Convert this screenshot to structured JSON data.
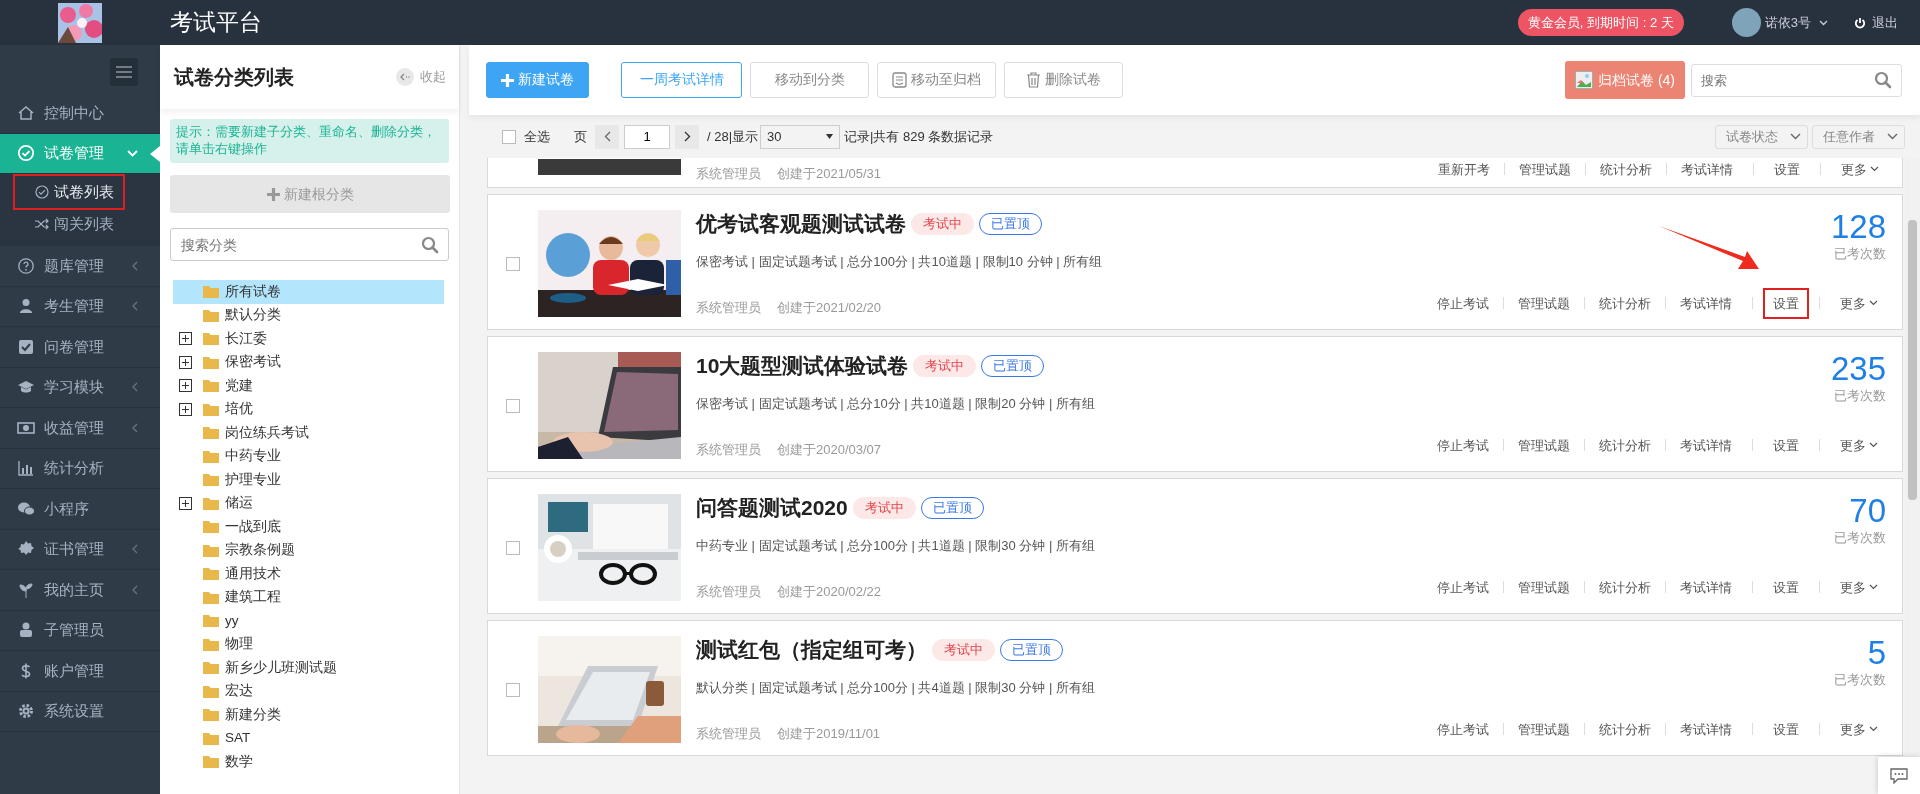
{
  "header": {
    "title": "考试平台",
    "membership": "黄金会员, 到期时间 : 2 天",
    "user": "诺依3号",
    "logout": "退出"
  },
  "sidebar": {
    "items": [
      {
        "label": "控制中心",
        "selected": false
      },
      {
        "label": "试卷管理",
        "selected": true,
        "expanded": true,
        "children": [
          {
            "label": "试卷列表",
            "selected": true,
            "highlighted": true
          },
          {
            "label": "闯关列表",
            "selected": false,
            "highlighted": false
          }
        ]
      },
      {
        "label": "题库管理",
        "selected": false,
        "expanded": false
      },
      {
        "label": "考生管理",
        "selected": false,
        "expanded": false
      },
      {
        "label": "问卷管理",
        "selected": false
      },
      {
        "label": "学习模块",
        "selected": false,
        "expanded": false
      },
      {
        "label": "收益管理",
        "selected": false,
        "expanded": false
      },
      {
        "label": "统计分析",
        "selected": false
      },
      {
        "label": "小程序",
        "selected": false
      },
      {
        "label": "证书管理",
        "selected": false,
        "expanded": false
      },
      {
        "label": "我的主页",
        "selected": false,
        "expanded": false
      },
      {
        "label": "子管理员",
        "selected": false
      },
      {
        "label": "账户管理",
        "selected": false
      },
      {
        "label": "系统设置",
        "selected": false
      }
    ]
  },
  "category_panel": {
    "title": "试卷分类列表",
    "collapse": "收起",
    "hint": "提示：需要新建子分类、重命名、删除分类，请单击右键操作",
    "new_root": "新建根分类",
    "search": {
      "placeholder": "搜索分类"
    },
    "tree": [
      {
        "label": "所有试卷",
        "has_children": false,
        "selected": true
      },
      {
        "label": "默认分类",
        "has_children": false,
        "selected": false
      },
      {
        "label": "长江委",
        "has_children": true,
        "selected": false
      },
      {
        "label": "保密考试",
        "has_children": true,
        "selected": false
      },
      {
        "label": "党建",
        "has_children": true,
        "selected": false
      },
      {
        "label": "培优",
        "has_children": true,
        "selected": false
      },
      {
        "label": "岗位练兵考试",
        "has_children": false,
        "selected": false
      },
      {
        "label": "中药专业",
        "has_children": false,
        "selected": false
      },
      {
        "label": "护理专业",
        "has_children": false,
        "selected": false
      },
      {
        "label": "储运",
        "has_children": true,
        "selected": false
      },
      {
        "label": "一战到底",
        "has_children": false,
        "selected": false
      },
      {
        "label": "宗教条例题",
        "has_children": false,
        "selected": false
      },
      {
        "label": "通用技术",
        "has_children": false,
        "selected": false
      },
      {
        "label": "建筑工程",
        "has_children": false,
        "selected": false
      },
      {
        "label": "yy",
        "has_children": false,
        "selected": false
      },
      {
        "label": "物理",
        "has_children": false,
        "selected": false
      },
      {
        "label": "新乡少儿班测试题",
        "has_children": false,
        "selected": false
      },
      {
        "label": "宏达",
        "has_children": false,
        "selected": false
      },
      {
        "label": "新建分类",
        "has_children": false,
        "selected": false
      },
      {
        "label": "SAT",
        "has_children": false,
        "selected": false
      },
      {
        "label": "数学",
        "has_children": false,
        "selected": false
      }
    ]
  },
  "toolbar": {
    "buttons": [
      {
        "label": "新建试卷",
        "kind": "primary"
      },
      {
        "label": "一周考试详情",
        "kind": "outline"
      },
      {
        "label": "移动到分类",
        "kind": "default"
      },
      {
        "label": "移动至归档",
        "kind": "default"
      },
      {
        "label": "删除试卷",
        "kind": "default"
      }
    ],
    "archive": "归档试卷 (4)",
    "search": {
      "placeholder": "搜索"
    }
  },
  "list_bar": {
    "select_all": {
      "label": "全选",
      "checked": false
    },
    "page_label": "页",
    "page": "1",
    "page_total": "/ 28",
    "show_label": "|显示",
    "per_page": "30",
    "records": "记录|共有 829 条数据记录",
    "filters": [
      "试卷状态",
      "任意作者"
    ]
  },
  "partial_card": {
    "author": "系统管理员",
    "created": "创建于2021/05/31",
    "actions": [
      "重新开考",
      "管理试题",
      "统计分析",
      "考试详情",
      "设置",
      "更多"
    ]
  },
  "cards": [
    {
      "title": "优考试客观题测试试卷",
      "checked": false,
      "tags": [
        {
          "label": "考试中",
          "kind": "status"
        },
        {
          "label": "已置顶",
          "kind": "pinned"
        }
      ],
      "meta": "保密考试 | 固定试题考试 | 总分100分 | 共10道题 | 限制10 分钟 | 所有组",
      "author": "系统管理员",
      "created": "创建于2021/02/20",
      "count": "128",
      "count_label": "已考次数",
      "actions": [
        {
          "label": "停止考试",
          "kind": "link",
          "highlighted": false
        },
        {
          "label": "管理试题",
          "kind": "link",
          "highlighted": false
        },
        {
          "label": "统计分析",
          "kind": "link",
          "highlighted": false
        },
        {
          "label": "考试详情",
          "kind": "link",
          "highlighted": false
        },
        {
          "label": "设置",
          "kind": "link",
          "highlighted": true
        },
        {
          "label": "更多",
          "kind": "dropdown",
          "highlighted": false
        }
      ]
    },
    {
      "title": "10大题型测试体验试卷",
      "checked": false,
      "tags": [
        {
          "label": "考试中",
          "kind": "status"
        },
        {
          "label": "已置顶",
          "kind": "pinned"
        }
      ],
      "meta": "保密考试 | 固定试题考试 | 总分10分 | 共10道题 | 限制20 分钟 | 所有组",
      "author": "系统管理员",
      "created": "创建于2020/03/07",
      "count": "235",
      "count_label": "已考次数",
      "actions": [
        {
          "label": "停止考试",
          "kind": "link",
          "highlighted": false
        },
        {
          "label": "管理试题",
          "kind": "link",
          "highlighted": false
        },
        {
          "label": "统计分析",
          "kind": "link",
          "highlighted": false
        },
        {
          "label": "考试详情",
          "kind": "link",
          "highlighted": false
        },
        {
          "label": "设置",
          "kind": "link",
          "highlighted": false
        },
        {
          "label": "更多",
          "kind": "dropdown",
          "highlighted": false
        }
      ]
    },
    {
      "title": "问答题测试2020",
      "checked": false,
      "tags": [
        {
          "label": "考试中",
          "kind": "status"
        },
        {
          "label": "已置顶",
          "kind": "pinned"
        }
      ],
      "meta": "中药专业 | 固定试题考试 | 总分100分 | 共1道题 | 限制30 分钟 | 所有组",
      "author": "系统管理员",
      "created": "创建于2020/02/22",
      "count": "70",
      "count_label": "已考次数",
      "actions": [
        {
          "label": "停止考试",
          "kind": "link",
          "highlighted": false
        },
        {
          "label": "管理试题",
          "kind": "link",
          "highlighted": false
        },
        {
          "label": "统计分析",
          "kind": "link",
          "highlighted": false
        },
        {
          "label": "考试详情",
          "kind": "link",
          "highlighted": false
        },
        {
          "label": "设置",
          "kind": "link",
          "highlighted": false
        },
        {
          "label": "更多",
          "kind": "dropdown",
          "highlighted": false
        }
      ]
    },
    {
      "title": "测试红包（指定组可考）",
      "checked": false,
      "tags": [
        {
          "label": "考试中",
          "kind": "status"
        },
        {
          "label": "已置顶",
          "kind": "pinned"
        }
      ],
      "meta": "默认分类 | 固定试题考试 | 总分100分 | 共4道题 | 限制30 分钟 | 所有组",
      "author": "系统管理员",
      "created": "创建于2019/11/01",
      "count": "5",
      "count_label": "已考次数",
      "actions": [
        {
          "label": "停止考试",
          "kind": "link",
          "highlighted": false
        },
        {
          "label": "管理试题",
          "kind": "link",
          "highlighted": false
        },
        {
          "label": "统计分析",
          "kind": "link",
          "highlighted": false
        },
        {
          "label": "考试详情",
          "kind": "link",
          "highlighted": false
        },
        {
          "label": "设置",
          "kind": "link",
          "highlighted": false
        },
        {
          "label": "更多",
          "kind": "dropdown",
          "highlighted": false
        }
      ]
    }
  ]
}
